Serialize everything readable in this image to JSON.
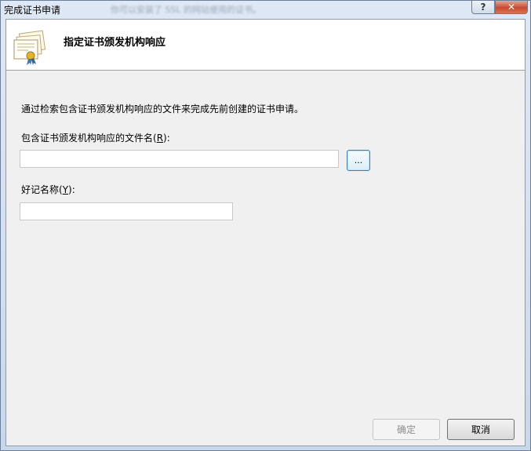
{
  "window": {
    "title": "完成证书申请",
    "background_title_hint": "你可以安装了 SSL 的网站使用的证书。",
    "help_glyph": "?",
    "close_glyph": "✕"
  },
  "header": {
    "icon": "certificate-icon",
    "title": "指定证书颁发机构响应"
  },
  "form": {
    "description": "通过检索包含证书颁发机构响应的文件来完成先前创建的证书申请。",
    "file_label": "包含证书颁发机构响应的文件名",
    "file_label_access_open": "(",
    "file_label_access_key": "R",
    "file_label_access_close": "):",
    "file_value": "",
    "browse_label": "...",
    "name_label": "好记名称",
    "name_label_access_open": "(",
    "name_label_access_key": "Y",
    "name_label_access_close": "):",
    "name_value": ""
  },
  "footer": {
    "ok_label": "确定",
    "cancel_label": "取消"
  }
}
